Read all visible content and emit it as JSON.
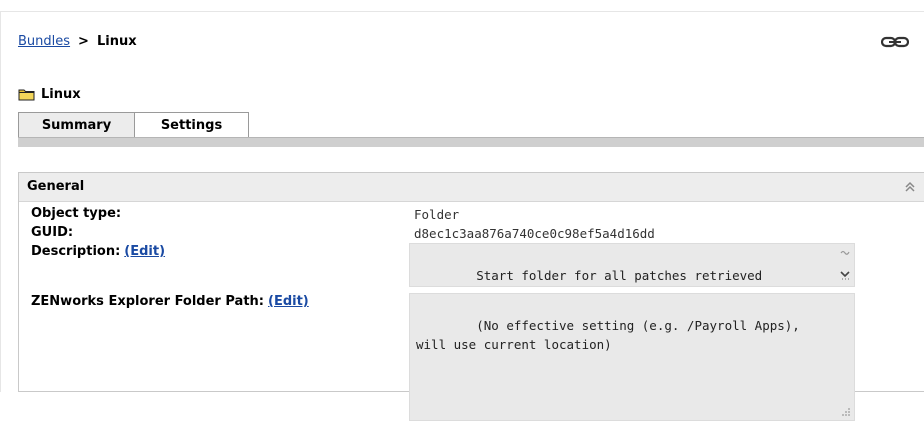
{
  "breadcrumb": {
    "root": "Bundles",
    "separator": ">",
    "current": "Linux"
  },
  "icons": {
    "link": "link-icon",
    "folder": "folder-icon",
    "collapse": "double-chevron-up-icon"
  },
  "title": "Linux",
  "tabs": [
    {
      "label": "Summary",
      "active": true
    },
    {
      "label": "Settings",
      "active": false
    }
  ],
  "panel": {
    "title": "General",
    "rows": [
      {
        "label": "Object type:",
        "value": "Folder"
      },
      {
        "label": "GUID:",
        "value": "d8ec1c3aa876a740ce0c98ef5a4d16dd"
      },
      {
        "label": "Description:",
        "edit": "(Edit)",
        "value": "Start folder for all patches retrieved\nfrom nu.novell.com. Usually SLES/SLED and"
      },
      {
        "label": "ZENworks Explorer Folder Path:",
        "edit": "(Edit)",
        "value": "(No effective setting (e.g. /Payroll Apps),\nwill use current location)"
      }
    ]
  },
  "colors": {
    "link": "#1a4aa3",
    "tab_bar": "#cfcfcf",
    "header_bg": "#ededed",
    "folder": "#e8c23a"
  }
}
